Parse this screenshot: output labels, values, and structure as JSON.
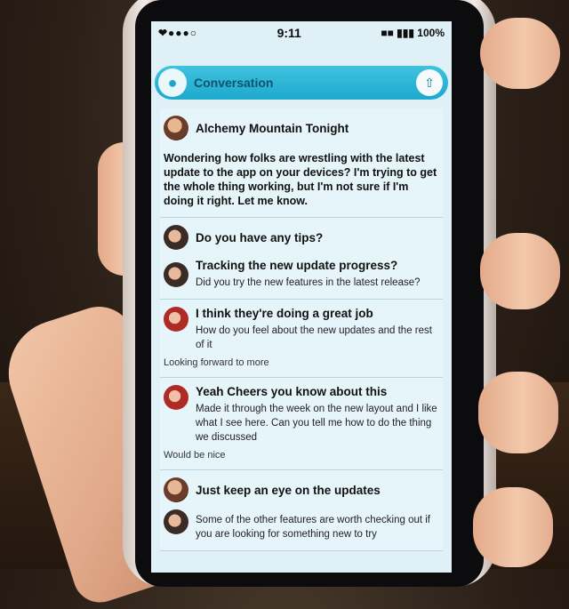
{
  "statusbar": {
    "left": "❤●●●○",
    "time": "9:11",
    "right": "■■ ▮▮▮ 100%"
  },
  "app": {
    "title": "Conversation",
    "action_icon": "share-icon"
  },
  "posts": [
    {
      "author_line": "Alchemy Mountain Tonight",
      "body": "Wondering how folks are wrestling with the latest update to the app on your devices? I'm trying to get the whole thing working, but I'm not sure if I'm doing it right. Let me know."
    },
    {
      "author_line": "Do you have any tips?",
      "body": ""
    },
    {
      "author_line": "Tracking the new update progress?",
      "body": "Did you try the new features in the latest release?"
    },
    {
      "author_line": "I think they're doing a great job",
      "body": "How do you feel about the new updates and the rest of it",
      "footer": "Looking forward to more"
    },
    {
      "author_line": "Yeah Cheers you know about this",
      "body": "Made it through the week on the new layout and I like what I see here. Can you tell me how to do the thing we discussed",
      "footer": "Would be nice"
    },
    {
      "author_line": "Just keep an eye on the updates",
      "body": ""
    },
    {
      "author_line": "",
      "body": "Some of the other features are worth checking out if you are looking for something new to try",
      "footer": ""
    }
  ]
}
